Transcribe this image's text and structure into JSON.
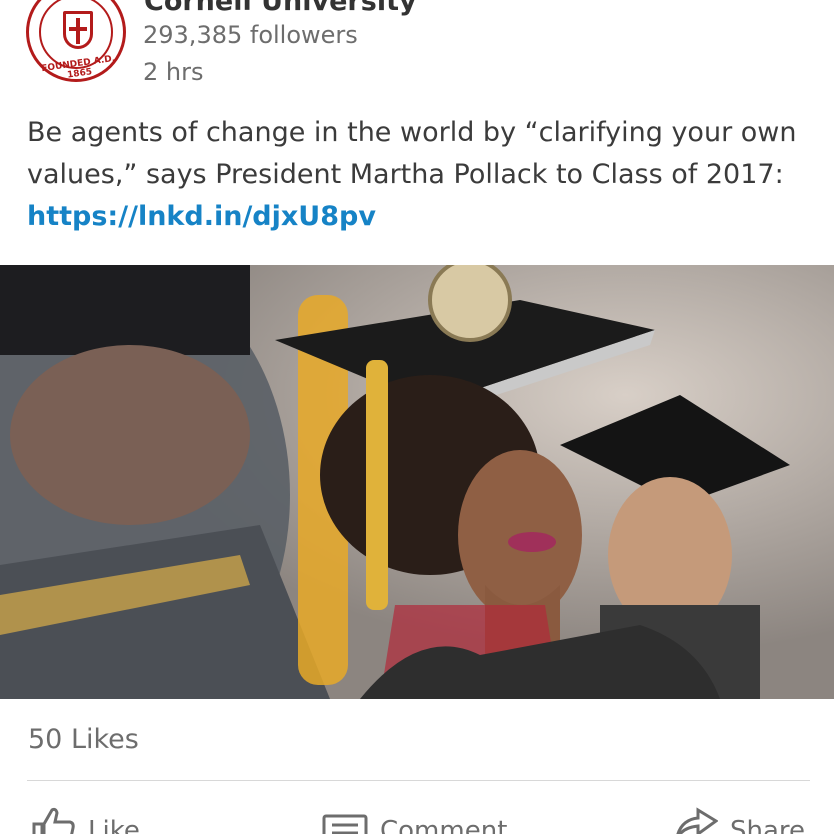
{
  "post": {
    "org_name": "Cornell University",
    "followers": "293,385 followers",
    "time": "2 hrs",
    "text": "Be agents of change in the world by “clarifying your own values,” says President Martha Pollack to Class of 2017:",
    "link": "https://lnkd.in/djxU8pv",
    "logo_text": "FOUNDED A.D. 1865"
  },
  "stats": {
    "likes": "50 Likes"
  },
  "actions": {
    "like": "Like",
    "comment": "Comment",
    "share": "Share"
  },
  "colors": {
    "brand_red": "#b31b1b",
    "link_blue": "#1683c6"
  }
}
